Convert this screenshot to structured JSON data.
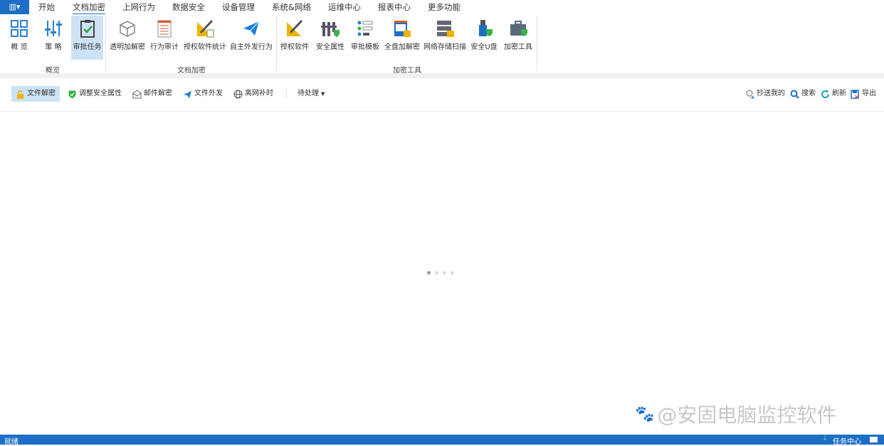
{
  "menu": {
    "app_button": "▥▾",
    "tabs": [
      "开始",
      "文档加密",
      "上网行为",
      "数据安全",
      "设备管理",
      "系统&网络",
      "运维中心",
      "报表中心",
      "更多功能"
    ],
    "active_tab": "文档加密"
  },
  "ribbon": {
    "groups": [
      {
        "label": "概览",
        "items": [
          "概 览",
          "策 略",
          "审批任务"
        ]
      },
      {
        "label": "文档加密",
        "items": [
          "透明加解密",
          "行为审计",
          "授权软件统计",
          "自主外发行为"
        ]
      },
      {
        "label": "加密工具",
        "items": [
          "授权软件",
          "安全属性",
          "审批模板",
          "全盘加解密",
          "网络存储扫描",
          "安全U盘",
          "加密工具"
        ]
      }
    ],
    "selected_item": "审批任务"
  },
  "toolbar": {
    "left": [
      "文件解密",
      "调整安全属性",
      "邮件解密",
      "文件外发",
      "离网补时"
    ],
    "filter": "待处理",
    "right": [
      "抄送我的",
      "搜索",
      "刷新",
      "导出"
    ],
    "selected": "文件解密"
  },
  "watermark": "@安固电脑监控软件",
  "status": {
    "left": "就绪",
    "task_center": "任务中心"
  },
  "colors": {
    "accent": "#1c6fc4",
    "selected": "#cce3f5"
  }
}
